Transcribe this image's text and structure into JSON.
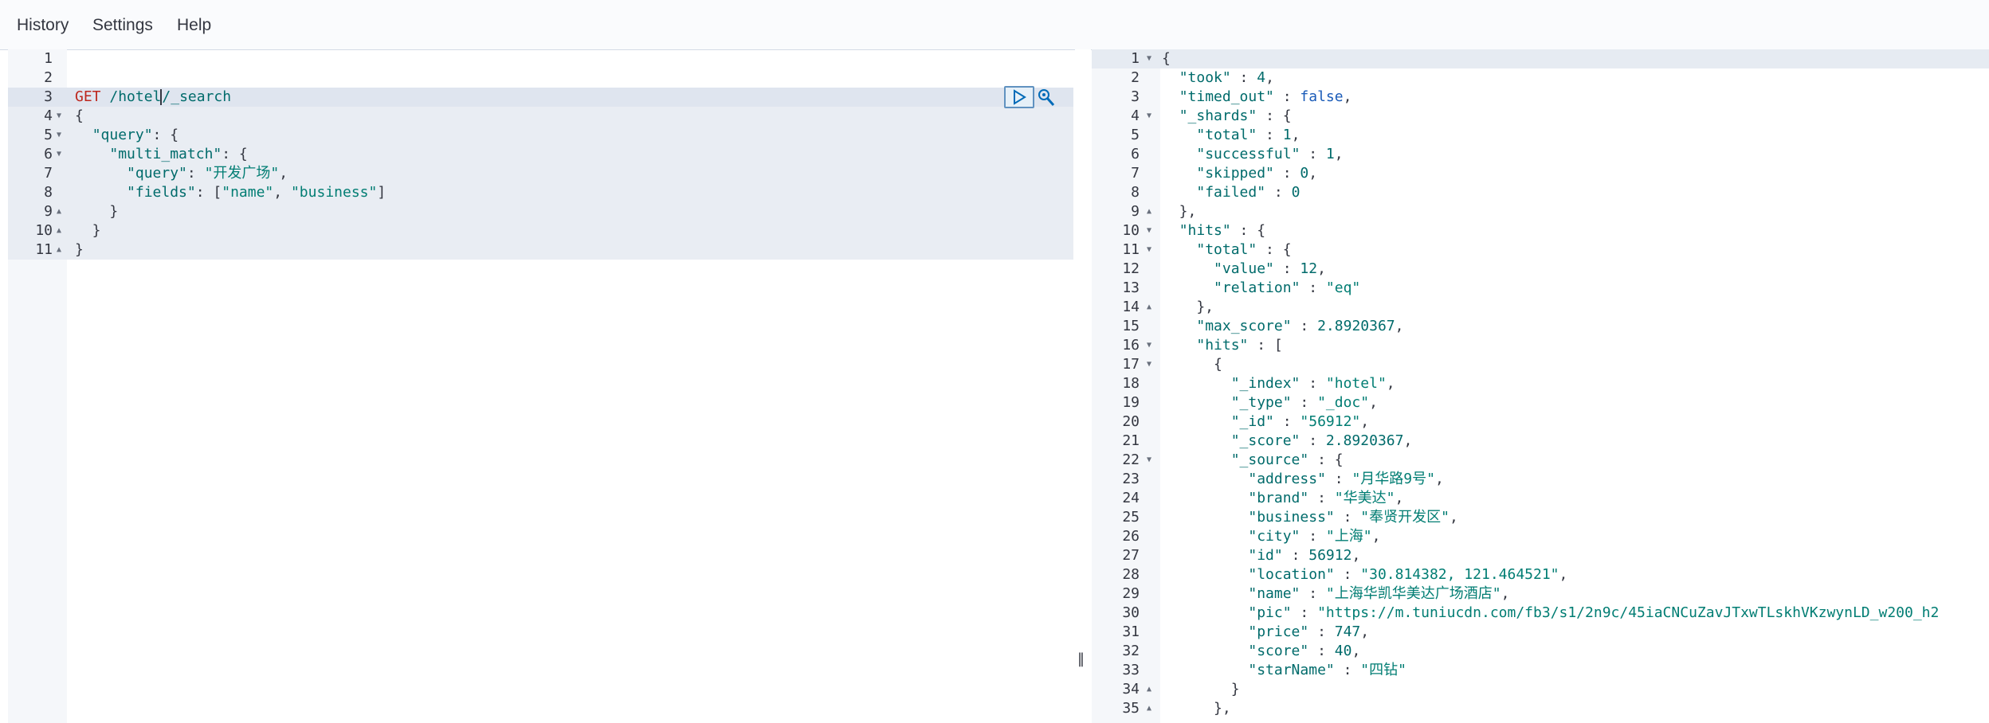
{
  "nav": {
    "history": "History",
    "settings": "Settings",
    "help": "Help"
  },
  "request": {
    "lines": [
      {
        "n": "1",
        "fold": "",
        "tokens": []
      },
      {
        "n": "2",
        "fold": "",
        "tokens": []
      },
      {
        "n": "3",
        "fold": "",
        "tokens": [
          {
            "t": "method",
            "v": "GET"
          },
          {
            "t": "punc",
            "v": " "
          },
          {
            "t": "url",
            "v": "/hotel"
          },
          {
            "t": "cursor",
            "v": ""
          },
          {
            "t": "url",
            "v": "/_search"
          }
        ]
      },
      {
        "n": "4",
        "fold": "▼",
        "tokens": [
          {
            "t": "punc",
            "v": "{"
          }
        ]
      },
      {
        "n": "5",
        "fold": "▼",
        "tokens": [
          {
            "t": "punc",
            "v": "  "
          },
          {
            "t": "key",
            "v": "\"query\""
          },
          {
            "t": "punc",
            "v": ": {"
          }
        ]
      },
      {
        "n": "6",
        "fold": "▼",
        "tokens": [
          {
            "t": "punc",
            "v": "    "
          },
          {
            "t": "key",
            "v": "\"multi_match\""
          },
          {
            "t": "punc",
            "v": ": {"
          }
        ]
      },
      {
        "n": "7",
        "fold": "",
        "tokens": [
          {
            "t": "punc",
            "v": "      "
          },
          {
            "t": "key",
            "v": "\"query\""
          },
          {
            "t": "punc",
            "v": ": "
          },
          {
            "t": "str",
            "v": "\"开发广场\""
          },
          {
            "t": "punc",
            "v": ","
          }
        ]
      },
      {
        "n": "8",
        "fold": "",
        "tokens": [
          {
            "t": "punc",
            "v": "      "
          },
          {
            "t": "key",
            "v": "\"fields\""
          },
          {
            "t": "punc",
            "v": ": ["
          },
          {
            "t": "str",
            "v": "\"name\""
          },
          {
            "t": "punc",
            "v": ", "
          },
          {
            "t": "str",
            "v": "\"business\""
          },
          {
            "t": "punc",
            "v": "]"
          }
        ]
      },
      {
        "n": "9",
        "fold": "▲",
        "tokens": [
          {
            "t": "punc",
            "v": "    }"
          }
        ]
      },
      {
        "n": "10",
        "fold": "▲",
        "tokens": [
          {
            "t": "punc",
            "v": "  }"
          }
        ]
      },
      {
        "n": "11",
        "fold": "▲",
        "tokens": [
          {
            "t": "punc",
            "v": "}"
          }
        ]
      }
    ]
  },
  "response": {
    "lines": [
      {
        "n": "1",
        "fold": "▼",
        "tokens": [
          {
            "t": "punc",
            "v": "{"
          }
        ]
      },
      {
        "n": "2",
        "fold": "",
        "tokens": [
          {
            "t": "punc",
            "v": "  "
          },
          {
            "t": "key",
            "v": "\"took\""
          },
          {
            "t": "punc",
            "v": " : "
          },
          {
            "t": "num",
            "v": "4"
          },
          {
            "t": "punc",
            "v": ","
          }
        ]
      },
      {
        "n": "3",
        "fold": "",
        "tokens": [
          {
            "t": "punc",
            "v": "  "
          },
          {
            "t": "key",
            "v": "\"timed_out\""
          },
          {
            "t": "punc",
            "v": " : "
          },
          {
            "t": "bool",
            "v": "false"
          },
          {
            "t": "punc",
            "v": ","
          }
        ]
      },
      {
        "n": "4",
        "fold": "▼",
        "tokens": [
          {
            "t": "punc",
            "v": "  "
          },
          {
            "t": "key",
            "v": "\"_shards\""
          },
          {
            "t": "punc",
            "v": " : {"
          }
        ]
      },
      {
        "n": "5",
        "fold": "",
        "tokens": [
          {
            "t": "punc",
            "v": "    "
          },
          {
            "t": "key",
            "v": "\"total\""
          },
          {
            "t": "punc",
            "v": " : "
          },
          {
            "t": "num",
            "v": "1"
          },
          {
            "t": "punc",
            "v": ","
          }
        ]
      },
      {
        "n": "6",
        "fold": "",
        "tokens": [
          {
            "t": "punc",
            "v": "    "
          },
          {
            "t": "key",
            "v": "\"successful\""
          },
          {
            "t": "punc",
            "v": " : "
          },
          {
            "t": "num",
            "v": "1"
          },
          {
            "t": "punc",
            "v": ","
          }
        ]
      },
      {
        "n": "7",
        "fold": "",
        "tokens": [
          {
            "t": "punc",
            "v": "    "
          },
          {
            "t": "key",
            "v": "\"skipped\""
          },
          {
            "t": "punc",
            "v": " : "
          },
          {
            "t": "num",
            "v": "0"
          },
          {
            "t": "punc",
            "v": ","
          }
        ]
      },
      {
        "n": "8",
        "fold": "",
        "tokens": [
          {
            "t": "punc",
            "v": "    "
          },
          {
            "t": "key",
            "v": "\"failed\""
          },
          {
            "t": "punc",
            "v": " : "
          },
          {
            "t": "num",
            "v": "0"
          }
        ]
      },
      {
        "n": "9",
        "fold": "▲",
        "tokens": [
          {
            "t": "punc",
            "v": "  },"
          }
        ]
      },
      {
        "n": "10",
        "fold": "▼",
        "tokens": [
          {
            "t": "punc",
            "v": "  "
          },
          {
            "t": "key",
            "v": "\"hits\""
          },
          {
            "t": "punc",
            "v": " : {"
          }
        ]
      },
      {
        "n": "11",
        "fold": "▼",
        "tokens": [
          {
            "t": "punc",
            "v": "    "
          },
          {
            "t": "key",
            "v": "\"total\""
          },
          {
            "t": "punc",
            "v": " : {"
          }
        ]
      },
      {
        "n": "12",
        "fold": "",
        "tokens": [
          {
            "t": "punc",
            "v": "      "
          },
          {
            "t": "key",
            "v": "\"value\""
          },
          {
            "t": "punc",
            "v": " : "
          },
          {
            "t": "num",
            "v": "12"
          },
          {
            "t": "punc",
            "v": ","
          }
        ]
      },
      {
        "n": "13",
        "fold": "",
        "tokens": [
          {
            "t": "punc",
            "v": "      "
          },
          {
            "t": "key",
            "v": "\"relation\""
          },
          {
            "t": "punc",
            "v": " : "
          },
          {
            "t": "str",
            "v": "\"eq\""
          }
        ]
      },
      {
        "n": "14",
        "fold": "▲",
        "tokens": [
          {
            "t": "punc",
            "v": "    },"
          }
        ]
      },
      {
        "n": "15",
        "fold": "",
        "tokens": [
          {
            "t": "punc",
            "v": "    "
          },
          {
            "t": "key",
            "v": "\"max_score\""
          },
          {
            "t": "punc",
            "v": " : "
          },
          {
            "t": "num",
            "v": "2.8920367"
          },
          {
            "t": "punc",
            "v": ","
          }
        ]
      },
      {
        "n": "16",
        "fold": "▼",
        "tokens": [
          {
            "t": "punc",
            "v": "    "
          },
          {
            "t": "key",
            "v": "\"hits\""
          },
          {
            "t": "punc",
            "v": " : ["
          }
        ]
      },
      {
        "n": "17",
        "fold": "▼",
        "tokens": [
          {
            "t": "punc",
            "v": "      {"
          }
        ]
      },
      {
        "n": "18",
        "fold": "",
        "tokens": [
          {
            "t": "punc",
            "v": "        "
          },
          {
            "t": "key",
            "v": "\"_index\""
          },
          {
            "t": "punc",
            "v": " : "
          },
          {
            "t": "str",
            "v": "\"hotel\""
          },
          {
            "t": "punc",
            "v": ","
          }
        ]
      },
      {
        "n": "19",
        "fold": "",
        "tokens": [
          {
            "t": "punc",
            "v": "        "
          },
          {
            "t": "key",
            "v": "\"_type\""
          },
          {
            "t": "punc",
            "v": " : "
          },
          {
            "t": "str",
            "v": "\"_doc\""
          },
          {
            "t": "punc",
            "v": ","
          }
        ]
      },
      {
        "n": "20",
        "fold": "",
        "tokens": [
          {
            "t": "punc",
            "v": "        "
          },
          {
            "t": "key",
            "v": "\"_id\""
          },
          {
            "t": "punc",
            "v": " : "
          },
          {
            "t": "str",
            "v": "\"56912\""
          },
          {
            "t": "punc",
            "v": ","
          }
        ]
      },
      {
        "n": "21",
        "fold": "",
        "tokens": [
          {
            "t": "punc",
            "v": "        "
          },
          {
            "t": "key",
            "v": "\"_score\""
          },
          {
            "t": "punc",
            "v": " : "
          },
          {
            "t": "num",
            "v": "2.8920367"
          },
          {
            "t": "punc",
            "v": ","
          }
        ]
      },
      {
        "n": "22",
        "fold": "▼",
        "tokens": [
          {
            "t": "punc",
            "v": "        "
          },
          {
            "t": "key",
            "v": "\"_source\""
          },
          {
            "t": "punc",
            "v": " : {"
          }
        ]
      },
      {
        "n": "23",
        "fold": "",
        "tokens": [
          {
            "t": "punc",
            "v": "          "
          },
          {
            "t": "key",
            "v": "\"address\""
          },
          {
            "t": "punc",
            "v": " : "
          },
          {
            "t": "str",
            "v": "\"月华路9号\""
          },
          {
            "t": "punc",
            "v": ","
          }
        ]
      },
      {
        "n": "24",
        "fold": "",
        "tokens": [
          {
            "t": "punc",
            "v": "          "
          },
          {
            "t": "key",
            "v": "\"brand\""
          },
          {
            "t": "punc",
            "v": " : "
          },
          {
            "t": "str",
            "v": "\"华美达\""
          },
          {
            "t": "punc",
            "v": ","
          }
        ]
      },
      {
        "n": "25",
        "fold": "",
        "tokens": [
          {
            "t": "punc",
            "v": "          "
          },
          {
            "t": "key",
            "v": "\"business\""
          },
          {
            "t": "punc",
            "v": " : "
          },
          {
            "t": "str",
            "v": "\"奉贤开发区\""
          },
          {
            "t": "punc",
            "v": ","
          }
        ]
      },
      {
        "n": "26",
        "fold": "",
        "tokens": [
          {
            "t": "punc",
            "v": "          "
          },
          {
            "t": "key",
            "v": "\"city\""
          },
          {
            "t": "punc",
            "v": " : "
          },
          {
            "t": "str",
            "v": "\"上海\""
          },
          {
            "t": "punc",
            "v": ","
          }
        ]
      },
      {
        "n": "27",
        "fold": "",
        "tokens": [
          {
            "t": "punc",
            "v": "          "
          },
          {
            "t": "key",
            "v": "\"id\""
          },
          {
            "t": "punc",
            "v": " : "
          },
          {
            "t": "num",
            "v": "56912"
          },
          {
            "t": "punc",
            "v": ","
          }
        ]
      },
      {
        "n": "28",
        "fold": "",
        "tokens": [
          {
            "t": "punc",
            "v": "          "
          },
          {
            "t": "key",
            "v": "\"location\""
          },
          {
            "t": "punc",
            "v": " : "
          },
          {
            "t": "str",
            "v": "\"30.814382, 121.464521\""
          },
          {
            "t": "punc",
            "v": ","
          }
        ]
      },
      {
        "n": "29",
        "fold": "",
        "tokens": [
          {
            "t": "punc",
            "v": "          "
          },
          {
            "t": "key",
            "v": "\"name\""
          },
          {
            "t": "punc",
            "v": " : "
          },
          {
            "t": "str",
            "v": "\"上海华凯华美达广场酒店\""
          },
          {
            "t": "punc",
            "v": ","
          }
        ]
      },
      {
        "n": "30",
        "fold": "",
        "tokens": [
          {
            "t": "punc",
            "v": "          "
          },
          {
            "t": "key",
            "v": "\"pic\""
          },
          {
            "t": "punc",
            "v": " : "
          },
          {
            "t": "str",
            "v": "\"https://m.tuniucdn.com/fb3/s1/2n9c/45iaCNCuZavJTxwTLskhVKzwynLD_w200_h2"
          }
        ]
      },
      {
        "n": "31",
        "fold": "",
        "tokens": [
          {
            "t": "punc",
            "v": "          "
          },
          {
            "t": "key",
            "v": "\"price\""
          },
          {
            "t": "punc",
            "v": " : "
          },
          {
            "t": "num",
            "v": "747"
          },
          {
            "t": "punc",
            "v": ","
          }
        ]
      },
      {
        "n": "32",
        "fold": "",
        "tokens": [
          {
            "t": "punc",
            "v": "          "
          },
          {
            "t": "key",
            "v": "\"score\""
          },
          {
            "t": "punc",
            "v": " : "
          },
          {
            "t": "num",
            "v": "40"
          },
          {
            "t": "punc",
            "v": ","
          }
        ]
      },
      {
        "n": "33",
        "fold": "",
        "tokens": [
          {
            "t": "punc",
            "v": "          "
          },
          {
            "t": "key",
            "v": "\"starName\""
          },
          {
            "t": "punc",
            "v": " : "
          },
          {
            "t": "str",
            "v": "\"四钻\""
          }
        ]
      },
      {
        "n": "34",
        "fold": "▲",
        "tokens": [
          {
            "t": "punc",
            "v": "        }"
          }
        ]
      },
      {
        "n": "35",
        "fold": "▲",
        "tokens": [
          {
            "t": "punc",
            "v": "      },"
          }
        ]
      }
    ]
  },
  "icons": {
    "run": "play-icon",
    "settings_wrench": "wrench-icon",
    "resizer": "resize-handle-icon"
  }
}
